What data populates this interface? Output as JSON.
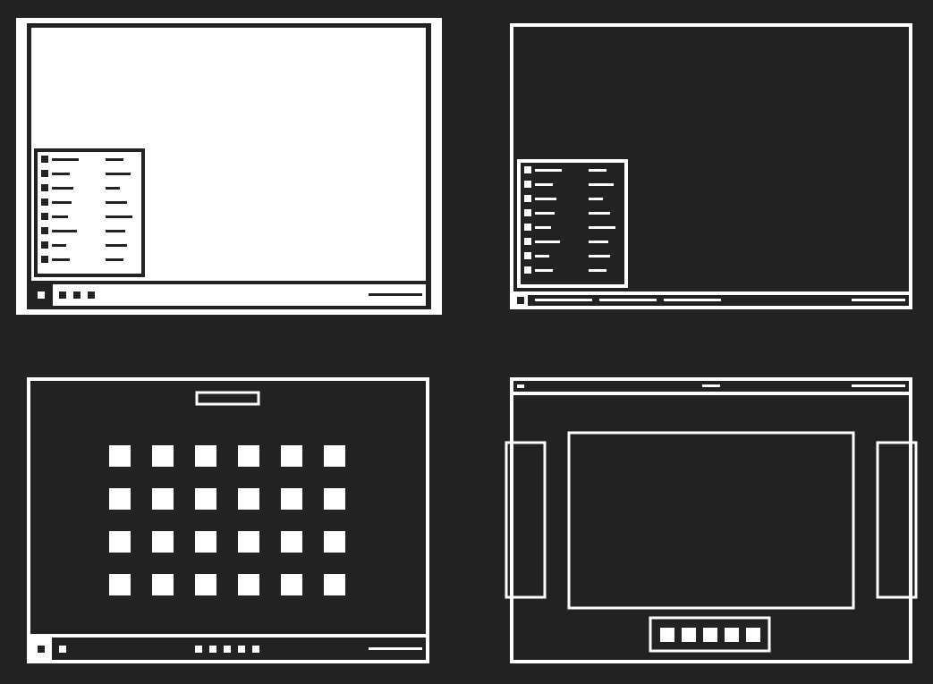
{
  "colors": {
    "background": "#222222",
    "ink": "#ffffff",
    "dark": "#222222"
  },
  "diagrams": [
    {
      "id": "light-desktop-start-menu",
      "theme": "light",
      "menu": {
        "rows": 8
      },
      "taskbar": {
        "start_button": "square-icon",
        "quick_launch_icons": 3,
        "tray": "clock-bar"
      }
    },
    {
      "id": "dark-desktop-start-menu",
      "theme": "dark",
      "menu": {
        "rows": 8
      },
      "taskbar": {
        "start_button": "square-icon",
        "open_window_buttons": 3,
        "tray": "clock-bar"
      }
    },
    {
      "id": "app-launcher-grid",
      "theme": "dark",
      "search_box": true,
      "app_grid": {
        "rows": 4,
        "cols": 6
      },
      "taskbar": {
        "start_button": "square-icon",
        "quick_launch_icons": 1,
        "pinned_icons": 5,
        "tray": "clock-bar"
      }
    },
    {
      "id": "top-bar-dock-layout",
      "theme": "dark",
      "top_bar": {
        "left_indicator": true,
        "center_label": true,
        "right_tray": true
      },
      "main_window": true,
      "side_panels": [
        "left",
        "right"
      ],
      "dock": {
        "icons": 5
      }
    }
  ]
}
